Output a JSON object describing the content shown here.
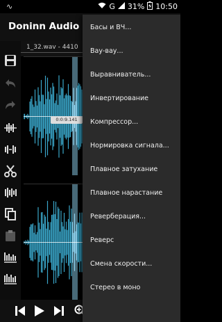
{
  "status_bar": {
    "notification_icon": "sound-wave-icon",
    "signal": "G",
    "battery": "31%",
    "time": "10:50"
  },
  "app": {
    "title": "Doninn Audio Editor"
  },
  "track": {
    "file_label": "1_32.wav - 4410",
    "selection_badge": "0:0:9.141"
  },
  "menu": {
    "items": [
      "Басы и ВЧ...",
      "Вау-вау...",
      "Выравниватель...",
      "Инвертирование",
      "Компрессор...",
      "Нормировка сигнала...",
      "Плавное затухание",
      "Плавное нарастание",
      "Реверберация...",
      "Реверс",
      "Смена скорости...",
      "Стерео в моно"
    ]
  },
  "colors": {
    "waveform": "#3aa6c9",
    "selection": "#8fd3f0",
    "menu_bg": "#2b2b2b"
  }
}
